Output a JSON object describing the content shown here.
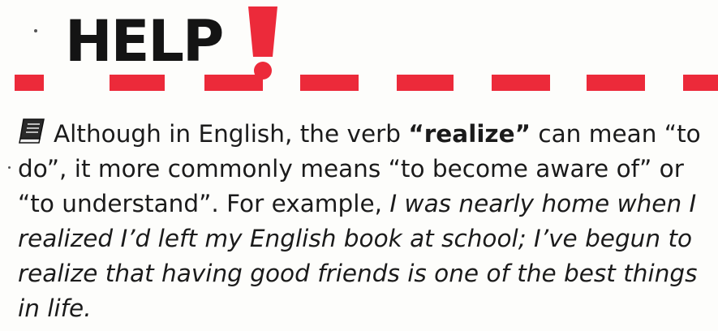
{
  "header": {
    "title": "HELP",
    "exclamation": "!"
  },
  "body": {
    "intro": "Although in English, the verb ",
    "term": "“realize”",
    "explanation": " can mean “to do”, it more commonly means “to become aware of” or “to understand”. For example, ",
    "example": "I was nearly home when I realized I’d left my English book at school; I’ve begun to realize that having good friends is one of the best things in life."
  },
  "icons": {
    "book": "book-icon",
    "exclamation_mark": "exclamation-icon"
  },
  "colors": {
    "accent_red": "#ec2a3a",
    "text": "#1b1b1b",
    "title": "#141414"
  }
}
